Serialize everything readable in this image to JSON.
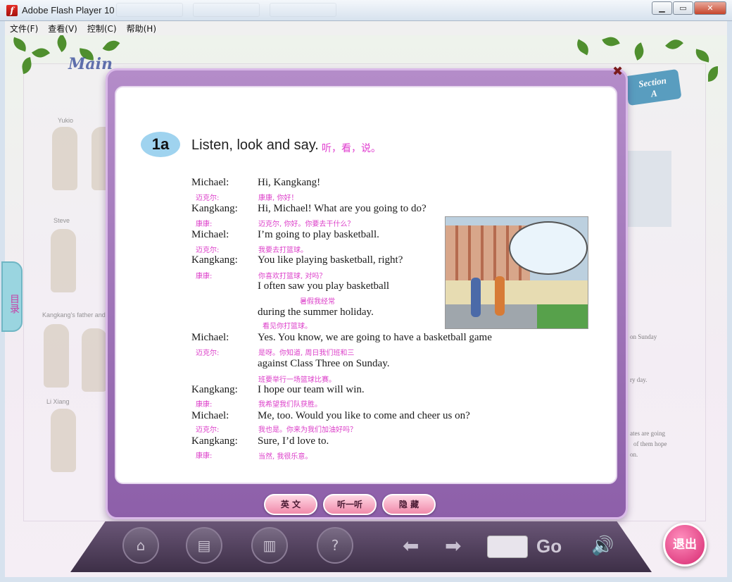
{
  "window": {
    "title": "Adobe Flash Player 10",
    "min_label": "▁",
    "max_label": "▭",
    "close_label": "✕"
  },
  "menu": [
    "文件(F)",
    "查看(V)",
    "控制(C)",
    "帮助(H)"
  ],
  "background": {
    "title": "Main",
    "names": [
      "Yukio",
      "Steve",
      "Kangkang's father and mother",
      "Li Xiang"
    ],
    "section_top": "Section",
    "section_letter": "A",
    "side_tab": "目录",
    "right_notes": [
      "on Sunday",
      "ry day.",
      "ates are going",
      "of them hope",
      "on."
    ]
  },
  "lesson": {
    "badge": "1a",
    "title": "Listen, look and say.",
    "title_cn": "听，看，说。",
    "dialogue": [
      {
        "speaker": "Michael:",
        "speaker_cn": "迈克尔:",
        "en": "Hi, Kangkang!",
        "cn": "康康, 你好！"
      },
      {
        "speaker": "Kangkang:",
        "speaker_cn": "康康:",
        "en": "Hi, Michael! What are you going to do?",
        "cn": "迈克尔, 你好。你要去干什么？"
      },
      {
        "speaker": "Michael:",
        "speaker_cn": "迈克尔:",
        "en": "I’m going to play basketball.",
        "cn": "我要去打篮球。"
      },
      {
        "speaker": "Kangkang:",
        "speaker_cn": "康康:",
        "en": "You like playing basketball, right?",
        "cn": "你喜欢打篮球, 对吗？"
      },
      {
        "speaker": "",
        "speaker_cn": "",
        "en": "I often saw you play basketball",
        "cn": "暑假我经常"
      },
      {
        "speaker": "",
        "speaker_cn": "",
        "en": "during the summer holiday.",
        "cn": "看见你打篮球。"
      },
      {
        "speaker": "Michael:",
        "speaker_cn": "迈克尔:",
        "en": "Yes. You know, we are going to have a basketball game",
        "cn": "是呀。你知道, 周日我们班和三"
      },
      {
        "speaker": "",
        "speaker_cn": "",
        "en": "against Class Three on Sunday.",
        "cn": "班要举行一场篮球比赛。"
      },
      {
        "speaker": "Kangkang:",
        "speaker_cn": "康康:",
        "en": "I hope our team will win.",
        "cn": "我希望我们队获胜。"
      },
      {
        "speaker": "Michael:",
        "speaker_cn": "迈克尔:",
        "en": "Me, too. Would you like to come and cheer us on?",
        "cn": "我也是。你来为我们加油好吗？"
      },
      {
        "speaker": "Kangkang:",
        "speaker_cn": "康康:",
        "en": "Sure, I’d love to.",
        "cn": "当然, 我很乐意。"
      }
    ]
  },
  "controls": {
    "english": "英 文",
    "listen": "听一听",
    "hide": "隐 藏"
  },
  "toolbar": {
    "home_icon": "⌂",
    "notes_icon": "▤",
    "book_icon": "▥",
    "help_icon": "?",
    "prev_icon": "⬅",
    "next_icon": "➡",
    "go": "Go",
    "speaker_icon": "🔊",
    "exit": "退出"
  }
}
